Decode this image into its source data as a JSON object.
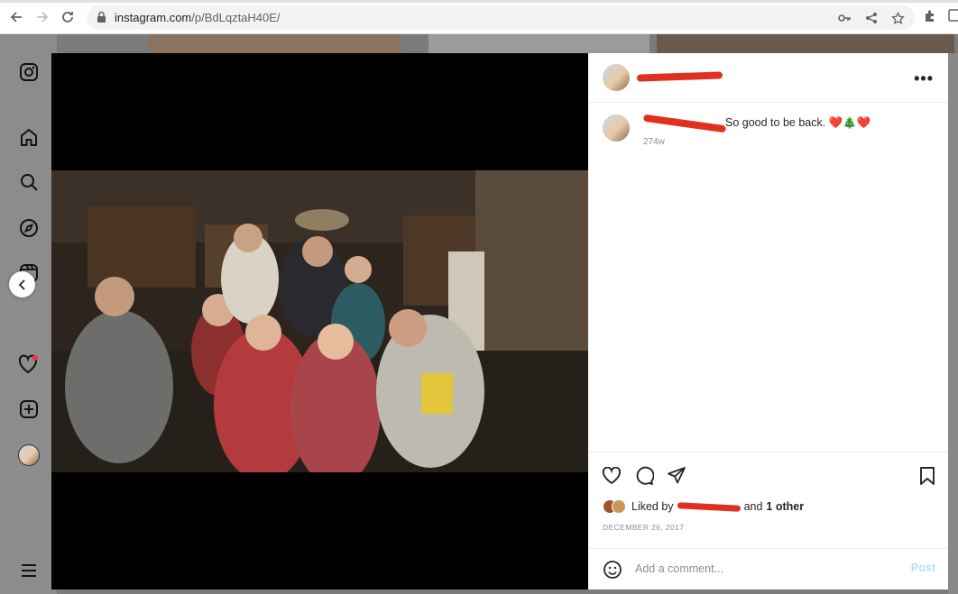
{
  "browser": {
    "url_host": "instagram.com",
    "url_path": "/p/BdLqztaH40E/"
  },
  "post": {
    "caption": "So good to be back. ❤️🎄❤️",
    "caption_age": "274w",
    "likes_prefix": "Liked by",
    "likes_suffix_and": "and",
    "likes_suffix_other": "1 other",
    "date": "DECEMBER 26, 2017"
  },
  "comment": {
    "placeholder": "Add a comment...",
    "post_label": "Post"
  },
  "icons": {
    "nav": [
      "instagram-logo-icon",
      "home-icon",
      "search-icon",
      "explore-icon",
      "reels-icon",
      "messenger-icon",
      "notifications-icon",
      "create-icon",
      "profile-avatar"
    ],
    "actions": [
      "like-icon",
      "comment-icon",
      "share-icon",
      "save-icon"
    ]
  },
  "colors": {
    "accent": "#0095f6",
    "post_disabled": "#b2dffc",
    "notification_dot": "#ff3040"
  }
}
